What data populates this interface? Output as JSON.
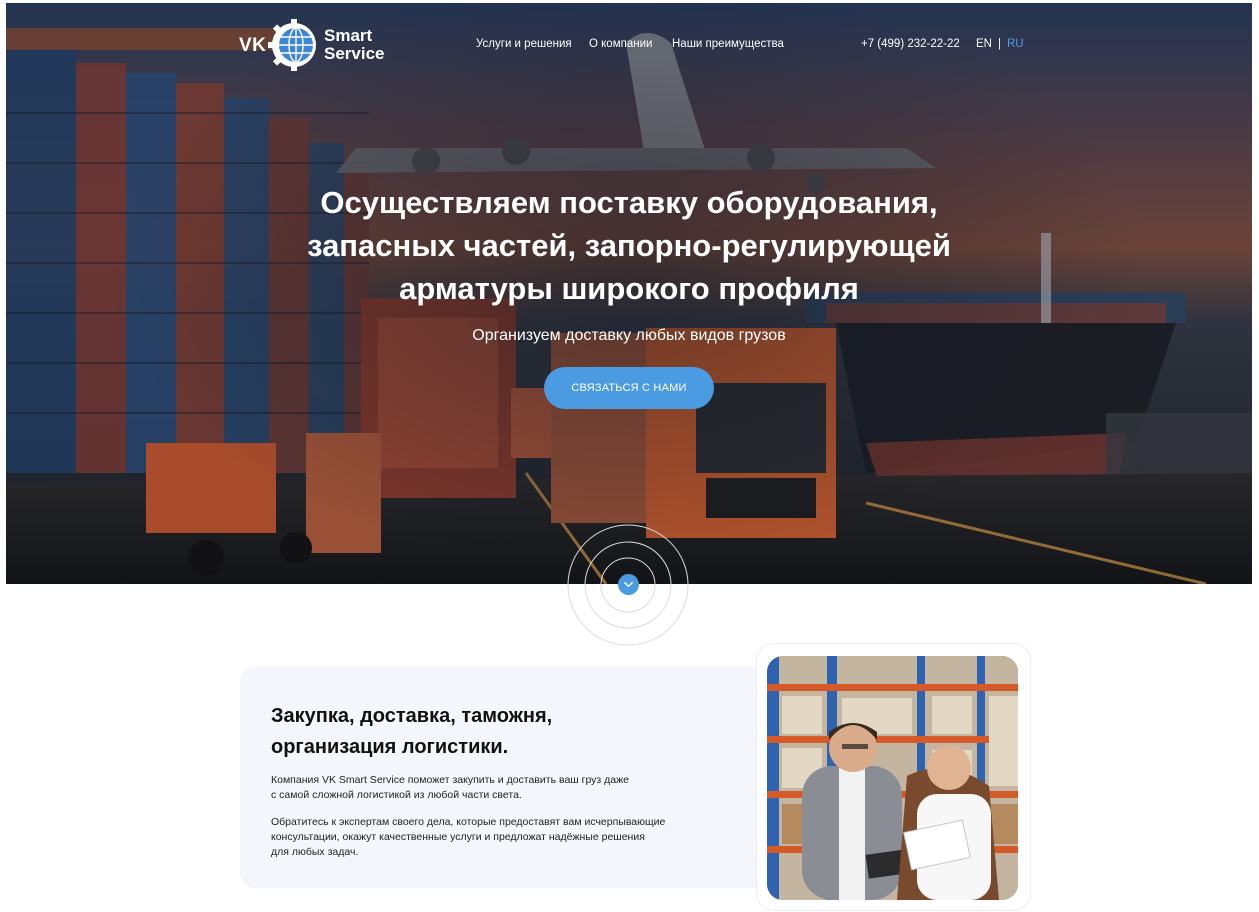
{
  "brand": {
    "vk": "VK",
    "line1": "Smart",
    "line2": "Service"
  },
  "nav": {
    "services": "Услуги и решения",
    "about": "О компании",
    "advantages": "Наши преимущества"
  },
  "phone": "+7 (499) 232-22-22",
  "lang": {
    "en": "EN",
    "separator": "|",
    "ru": "RU"
  },
  "hero": {
    "title_line1": "Осуществляем поставку оборудования,",
    "title_line2": "запасных частей, запорно-регулирующей",
    "title_line3": "арматуры широкого профиля",
    "subtitle": "Организуем доставку любых видов грузов",
    "cta": "СВЯЗАТЬСЯ С НАМИ"
  },
  "section": {
    "title_line1": "Закупка, доставка, таможня,",
    "title_line2": "организация логистики.",
    "p1_line1": "Компания VK Smart Service поможет закупить и доставить ваш груз даже",
    "p1_line2": "с самой сложной логистикой из любой части света.",
    "p2_line1": "Обратитесь к экспертам своего дела, которые предоставят вам исчерпывающие",
    "p2_line2": "консультации, окажут качественные услуги и предложат надёжные решения",
    "p2_line3": "для любых задач."
  },
  "colors": {
    "accent": "#4a9be2",
    "card_bg": "#f5f5fc",
    "text_dark": "#111111"
  },
  "icons": {
    "logo": "globe-gear-icon",
    "scroll": "chevron-down-icon"
  }
}
